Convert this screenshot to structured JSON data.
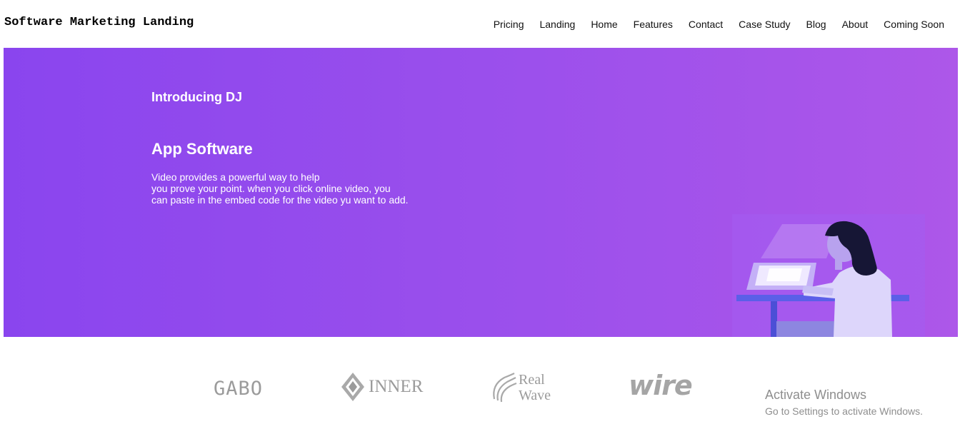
{
  "header": {
    "brand": "Software Marketing Landing",
    "nav": [
      "Pricing",
      "Landing",
      "Home",
      "Features",
      "Contact",
      "Case Study",
      "Blog",
      "About",
      "Coming Soon"
    ]
  },
  "hero": {
    "intro": "Introducing DJ",
    "title": "App Software",
    "description_lines": [
      "Video provides a powerful way to help",
      "you prove your point. when you click online video, you",
      "can paste in the embed code for the video yu want to add."
    ],
    "gradient": [
      "#8a45ee",
      "#ad57e9"
    ],
    "illustration": "woman-at-laptop-illustration"
  },
  "logos": {
    "gabo": "GABO",
    "inner": "INNER",
    "real_wave": [
      "Real",
      "Wave"
    ],
    "wire": "wire"
  },
  "watermark": {
    "title": "Activate Windows",
    "subtitle": "Go to Settings to activate Windows."
  }
}
